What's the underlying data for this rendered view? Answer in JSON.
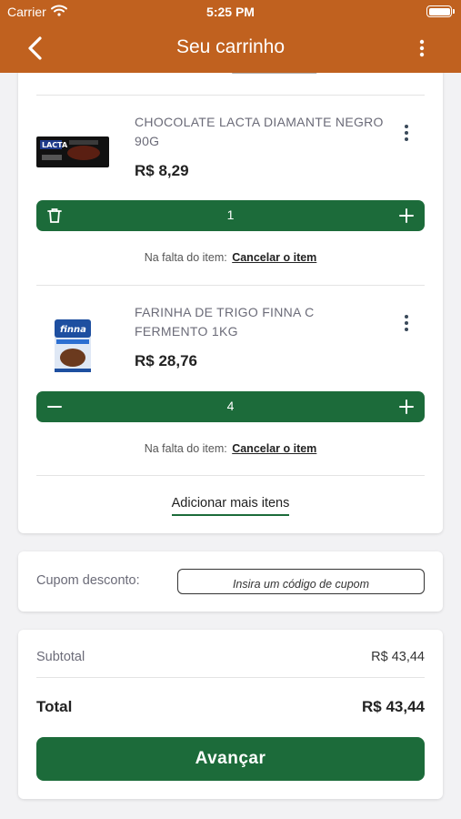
{
  "status_bar": {
    "carrier": "Carrier",
    "time": "5:25 PM"
  },
  "nav": {
    "title": "Seu carrinho",
    "back_icon": "chevron-left-icon",
    "menu_icon": "kebab-vertical-icon"
  },
  "items": [
    {
      "name": "CHOCOLATE LACTA DIAMANTE NEGRO 90G",
      "price": "R$ 8,29",
      "quantity": "1",
      "left_action_icon": "trash-icon",
      "lack_label": "Na falta do item:",
      "lack_action": "Cancelar o item"
    },
    {
      "name": "FARINHA DE TRIGO FINNA C FERMENTO 1KG",
      "price": "R$ 28,76",
      "quantity": "4",
      "left_action_icon": "minus-icon",
      "lack_label": "Na falta do item:",
      "lack_action": "Cancelar o item"
    }
  ],
  "add_more": "Adicionar mais itens",
  "coupon": {
    "label": "Cupom desconto:",
    "placeholder": "Insira um código de cupom"
  },
  "totals": {
    "subtotal_label": "Subtotal",
    "subtotal_value": "R$ 43,44",
    "total_label": "Total",
    "total_value": "R$ 43,44"
  },
  "advance_label": "Avançar",
  "colors": {
    "header": "#c0611f",
    "primary_green": "#1c6b3a",
    "background": "#f2f2f4"
  }
}
